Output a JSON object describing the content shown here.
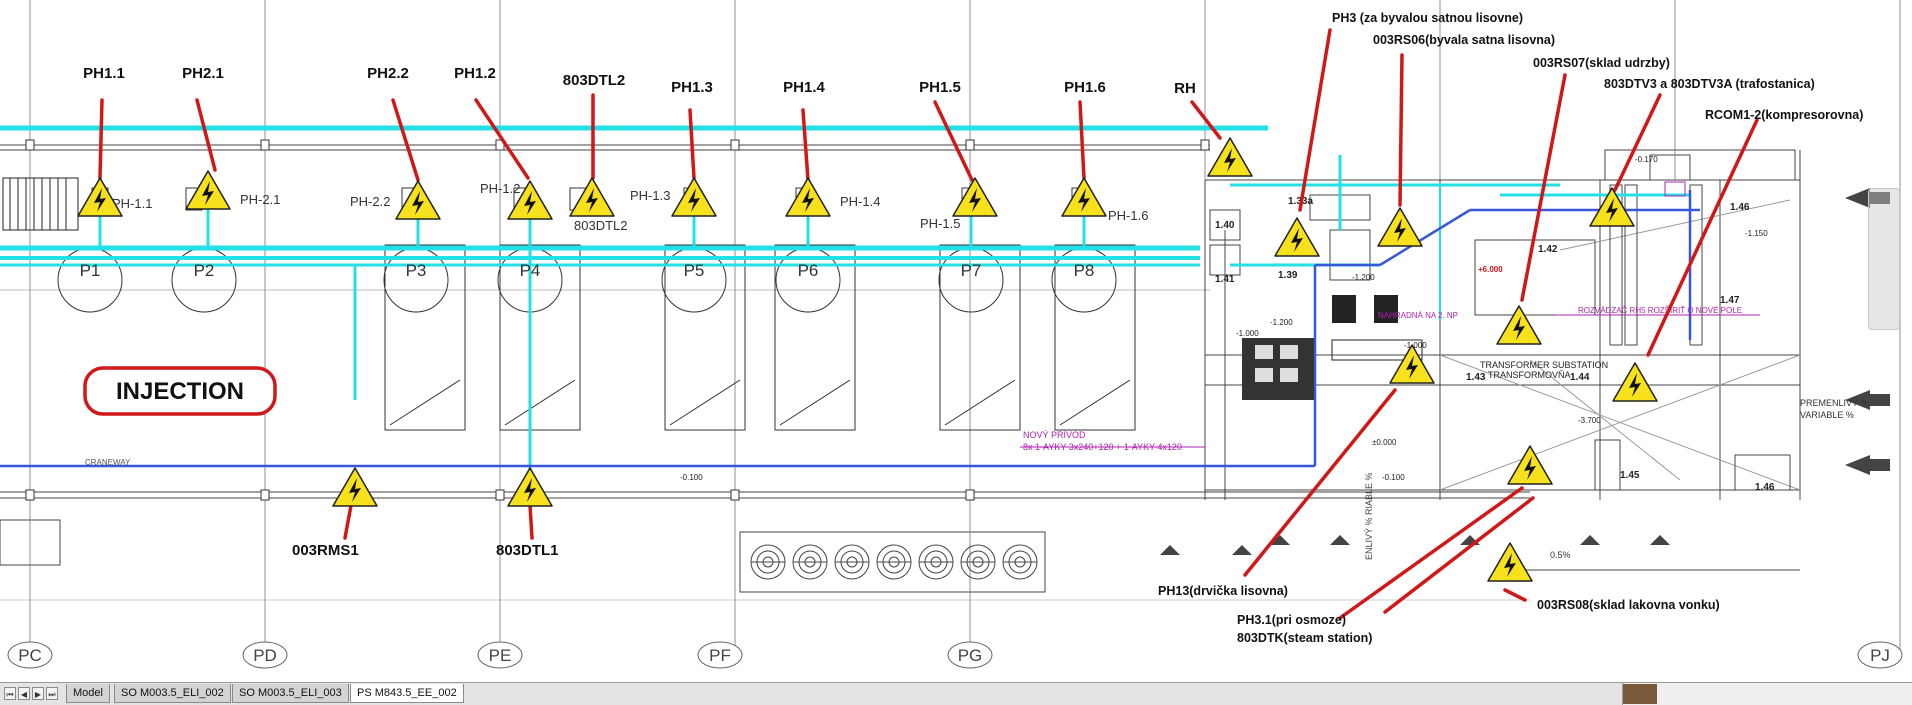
{
  "drawing": {
    "tags_top": [
      {
        "text": "PH1.1"
      },
      {
        "text": "PH2.1"
      },
      {
        "text": "PH2.2"
      },
      {
        "text": "PH1.2"
      },
      {
        "text": "803DTL2"
      },
      {
        "text": "PH1.3"
      },
      {
        "text": "PH1.4"
      },
      {
        "text": "PH1.5"
      },
      {
        "text": "PH1.6"
      },
      {
        "text": "RH"
      }
    ],
    "tags_right": [
      {
        "text": "PH3 (za byvalou satnou lisovne)"
      },
      {
        "text": "003RS06(byvala satna lisovna)"
      },
      {
        "text": "003RS07(sklad udrzby)"
      },
      {
        "text": "803DTV3 a 803DTV3A (trafostanica)"
      },
      {
        "text": "RCOM1-2(kompresorovna)"
      }
    ],
    "tags_bottom": [
      {
        "text": "003RMS1"
      },
      {
        "text": "803DTL1"
      },
      {
        "text": "PH13(drvička lisovna)"
      },
      {
        "text": "PH3.1(pri osmoze)"
      },
      {
        "text": "803DTK(steam station)"
      },
      {
        "text": "003RS08(sklad lakovna vonku)"
      }
    ],
    "injection_label": "INJECTION",
    "press_labels": [
      "P1",
      "P2",
      "P3",
      "P4",
      "P5",
      "P6",
      "P7",
      "P8"
    ],
    "panel_labels": [
      "PH-1.1",
      "PH-2.1",
      "PH-2.2",
      "PH-1.2",
      "803DTL2",
      "PH-1.3",
      "PH-1.4",
      "PH-1.5",
      "PH-1.6"
    ],
    "grid_labels": [
      "PC",
      "PD",
      "PE",
      "PF",
      "PG",
      "PJ"
    ],
    "room_numbers": [
      "1.33a",
      "1.39",
      "1.41",
      "1.40",
      "1.42",
      "1.46",
      "1.47",
      "1.43",
      "1.44",
      "1.45",
      "1.46"
    ],
    "levels": [
      "-1.200",
      "-1.000",
      "-1.200",
      "-1.000",
      "-1.150",
      "-0.170",
      "+6.000",
      "±0.000",
      "-0.100",
      "-0.100",
      "-3.700"
    ],
    "small_texts": {
      "craneway": "CRANEWAY",
      "novy_line1": "NOVÝ PRÍVOD",
      "novy_line2": "8x 1-AYKY 3x240+120 + 1-AYKY 4x120",
      "transformer_line1": "TRANSFORMER SUBSTATION",
      "transformer_line2": "TRANSFORMOVŇA",
      "rozvadzac": "ROZVÁDZAČ RH5 ROZŠÍRIŤ O NOVÉ POLE",
      "premenlivy1": "PREMENLIVÝ %",
      "premenlivy2": "VARIABLE %",
      "pct_label": "0.5%",
      "rotated_text": "ENLIVÝ % RIABLE %",
      "nahradna": "NÁHRADNÁ NA 2. NP"
    }
  },
  "tabs": {
    "nav": [
      "⏮",
      "◀",
      "▶",
      "⏭"
    ],
    "items": [
      {
        "label": "Model"
      },
      {
        "label": "SO M003.5_ELI_002"
      },
      {
        "label": "SO M003.5_ELI_003"
      },
      {
        "label": "PS M843.5_EE_002",
        "active": true
      }
    ]
  },
  "colors": {
    "cyan": "#22e0e6",
    "blue": "#3a56d8",
    "red": "#d01818",
    "magenta": "#b020b0",
    "warning_fill": "#f7e11c",
    "line": "#1a1a1a"
  }
}
